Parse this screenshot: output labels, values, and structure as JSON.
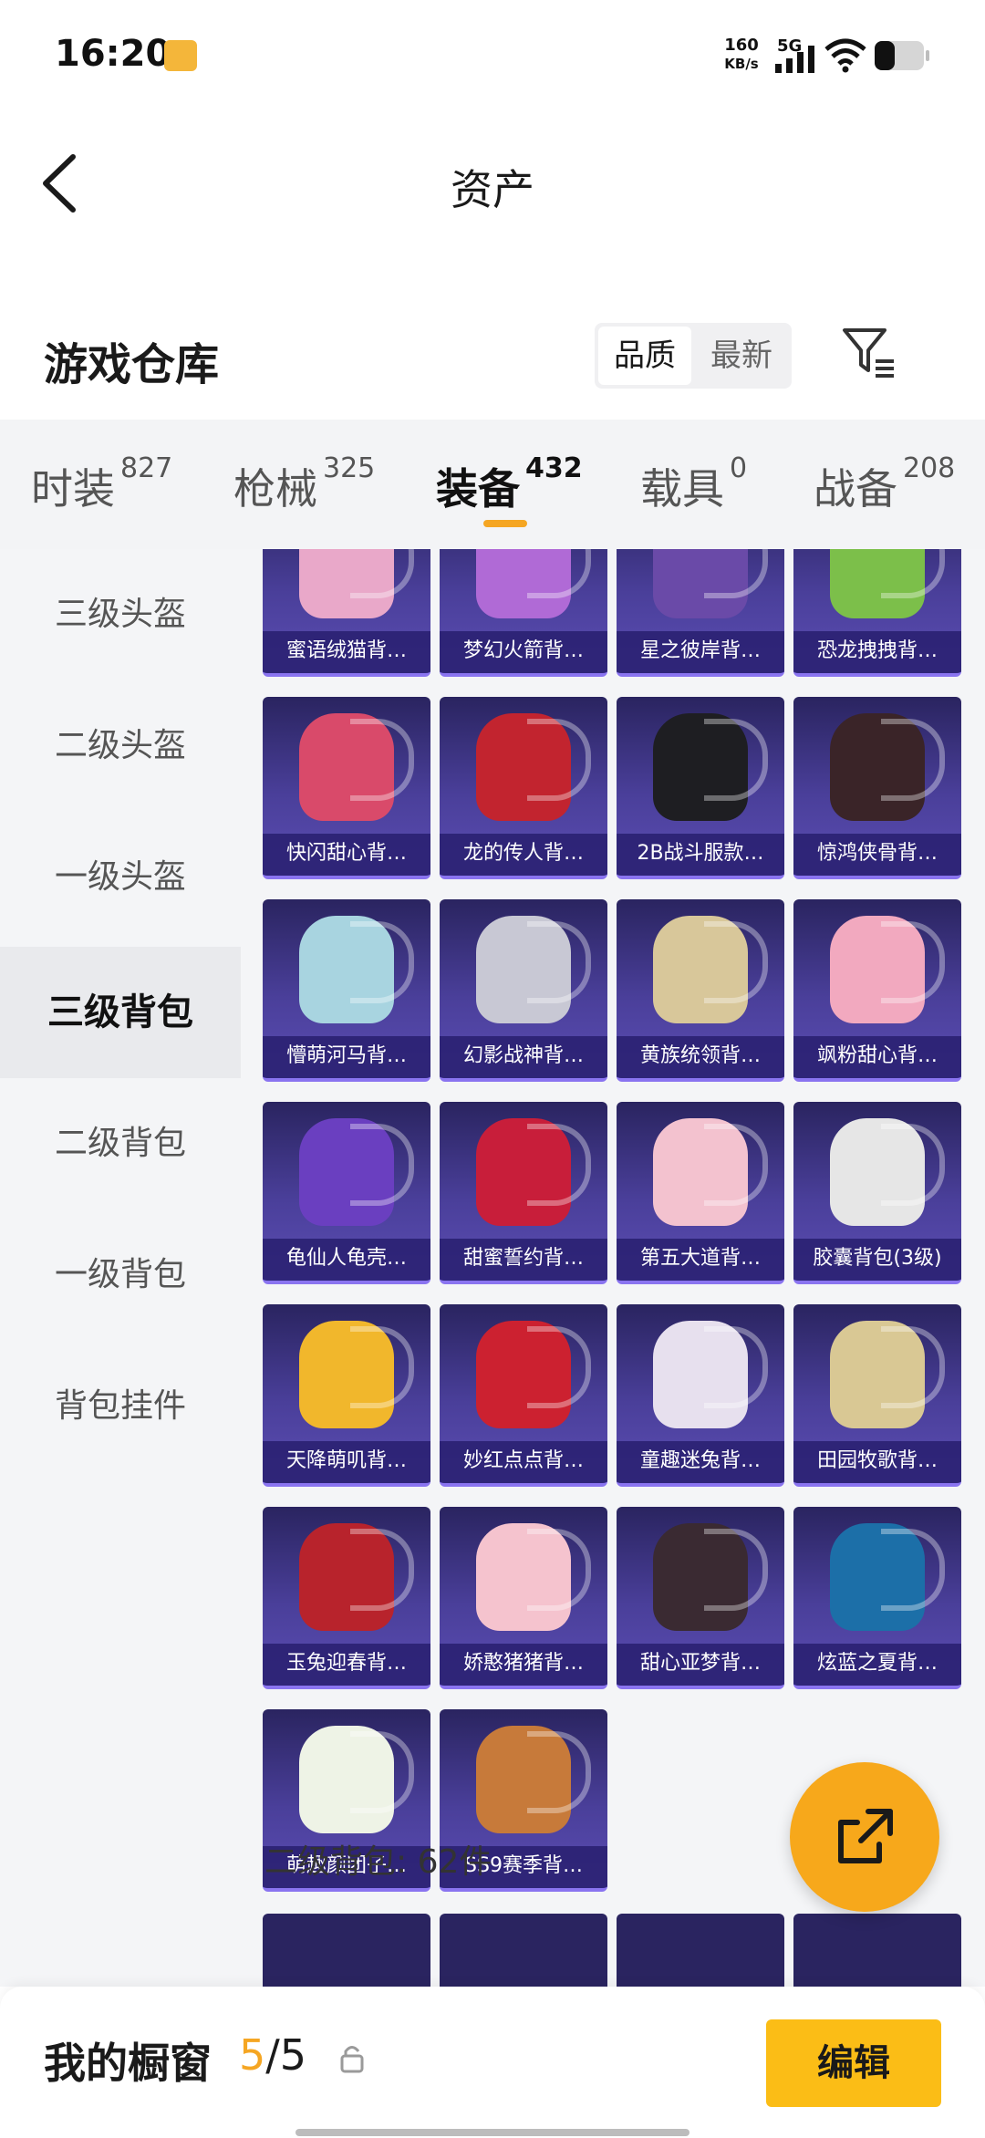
{
  "status_bar": {
    "time": "16:20",
    "net_speed_value": "160",
    "net_speed_unit": "KB/s",
    "network": "5G",
    "icons": [
      "signal-icon",
      "wifi-icon",
      "battery-icon"
    ]
  },
  "header": {
    "title": "资产",
    "back_icon": "back-chevron-icon"
  },
  "warehouse": {
    "title": "游戏仓库",
    "sort_options": [
      "品质",
      "最新"
    ],
    "selected_sort": "品质",
    "filter_icon": "filter-icon"
  },
  "tabs": [
    {
      "label": "时装",
      "count": "827"
    },
    {
      "label": "枪械",
      "count": "325"
    },
    {
      "label": "装备",
      "count": "432"
    },
    {
      "label": "载具",
      "count": "0"
    },
    {
      "label": "战备",
      "count": "208"
    }
  ],
  "active_tab": "装备",
  "sidebar": {
    "items": [
      "三级头盔",
      "二级头盔",
      "一级头盔",
      "三级背包",
      "二级背包",
      "一级背包",
      "背包挂件"
    ],
    "active": "三级背包"
  },
  "items": [
    {
      "label": "蜜语绒猫背…",
      "color": "#e9a8c9"
    },
    {
      "label": "梦幻火箭背…",
      "color": "#b06ad6"
    },
    {
      "label": "星之彼岸背…",
      "color": "#6a4aa8"
    },
    {
      "label": "恐龙拽拽背…",
      "color": "#7cbf4a"
    },
    {
      "label": "快闪甜心背…",
      "color": "#d94a6a"
    },
    {
      "label": "龙的传人背…",
      "color": "#c2242f"
    },
    {
      "label": "2B战斗服款…",
      "color": "#1e1e22"
    },
    {
      "label": "惊鸿侠骨背…",
      "color": "#3a2428"
    },
    {
      "label": "懵萌河马背…",
      "color": "#a8d4e0"
    },
    {
      "label": "幻影战神背…",
      "color": "#c8c8d4"
    },
    {
      "label": "黄族统领背…",
      "color": "#d8c79a"
    },
    {
      "label": "飒粉甜心背…",
      "color": "#f2a9bf"
    },
    {
      "label": "龟仙人龟壳…",
      "color": "#6a3fc0"
    },
    {
      "label": "甜蜜誓约背…",
      "color": "#c81e3a"
    },
    {
      "label": "第五大道背…",
      "color": "#f3c2cf"
    },
    {
      "label": "胶囊背包(3级)",
      "color": "#e6e6e6"
    },
    {
      "label": "天降萌叽背…",
      "color": "#f1b72c"
    },
    {
      "label": "妙红点点背…",
      "color": "#cc2130"
    },
    {
      "label": "童趣迷兔背…",
      "color": "#e7e0ee"
    },
    {
      "label": "田园牧歌背…",
      "color": "#d9c894"
    },
    {
      "label": "玉兔迎春背…",
      "color": "#b8232c"
    },
    {
      "label": "娇憨猪猪背…",
      "color": "#f5c3ce"
    },
    {
      "label": "甜心亚梦背…",
      "color": "#3a2a32"
    },
    {
      "label": "炫蓝之夏背…",
      "color": "#1c6fa8"
    },
    {
      "label": "萌趣颜团子…",
      "color": "#eef3e6"
    },
    {
      "label": "SS9赛季背…",
      "color": "#c77a3a"
    }
  ],
  "section_label": "二级背包: 62件",
  "next_section_colors": [
    "#2a2460",
    "#2a2460",
    "#2a2460",
    "#2a2460"
  ],
  "fab": {
    "icon": "share-export-icon",
    "color": "#f7a81b"
  },
  "bottom": {
    "title": "我的橱窗",
    "current": "5",
    "separator": "/",
    "total": "5",
    "lock_icon": "lock-icon",
    "edit_label": "编辑"
  },
  "accent_color": "#f5a623"
}
